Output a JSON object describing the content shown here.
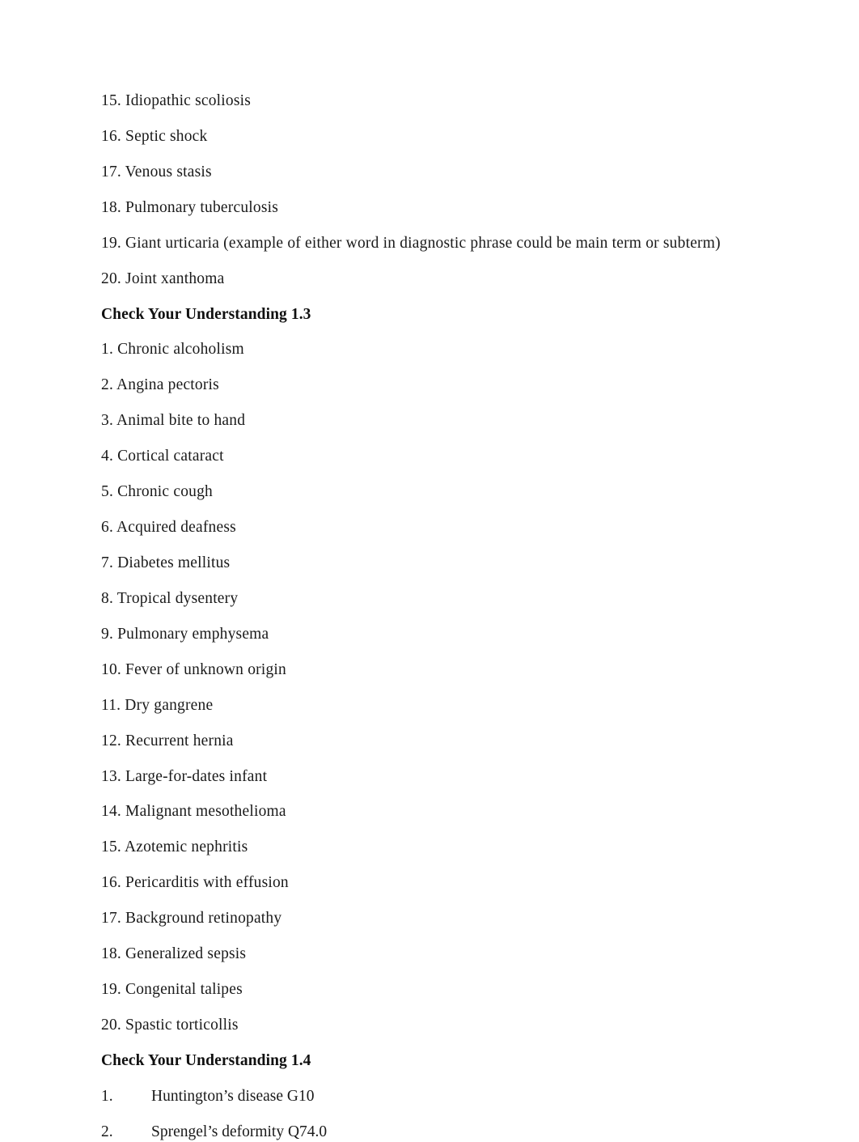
{
  "document": {
    "sections": [
      {
        "id": "cyu-1-2-continued",
        "heading": null,
        "list_style": "inline-number",
        "items": [
          "15. Idiopathic scoliosis",
          "16. Septic shock",
          "17. Venous stasis",
          "18. Pulmonary tuberculosis",
          "19. Giant urticaria (example of either word in diagnostic phrase could be main term or subterm)",
          "20. Joint xanthoma"
        ]
      },
      {
        "id": "cyu-1-3",
        "heading": "Check Your Understanding 1.3",
        "list_style": "inline-number",
        "items": [
          "1. Chronic alcoholism",
          "2. Angina pectoris",
          "3. Animal bite to hand",
          "4. Cortical cataract",
          "5. Chronic cough",
          "6. Acquired deafness",
          "7. Diabetes mellitus",
          "8. Tropical dysentery",
          "9. Pulmonary emphysema",
          "10. Fever of unknown origin",
          "11. Dry gangrene",
          "12. Recurrent hernia",
          "13. Large-for-dates infant",
          "14. Malignant mesothelioma",
          "15. Azotemic nephritis",
          "16. Pericarditis with effusion",
          "17. Background retinopathy",
          "18. Generalized sepsis",
          "19. Congenital talipes",
          "20. Spastic torticollis"
        ]
      },
      {
        "id": "cyu-1-4",
        "heading": "Check Your Understanding 1.4",
        "list_style": "tabbed-number",
        "tabbed_items": [
          {
            "number": "1.",
            "text": "Huntington’s disease G10"
          },
          {
            "number": "2.",
            "text": "Sprengel’s deformity Q74.0"
          }
        ]
      }
    ]
  }
}
